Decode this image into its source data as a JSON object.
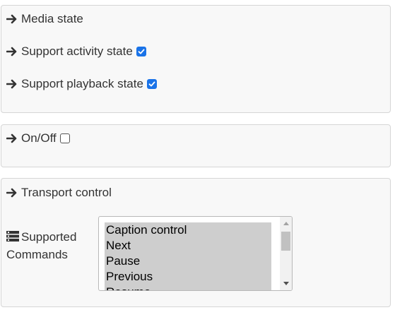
{
  "media_state": {
    "title": "Media state",
    "support_activity_label": "Support activity state",
    "support_activity_checked": true,
    "support_playback_label": "Support playback state",
    "support_playback_checked": true
  },
  "on_off": {
    "label": "On/Off",
    "checked": false
  },
  "transport": {
    "title": "Transport control",
    "commands_label_line1": "Supported",
    "commands_label_line2": "Commands",
    "options": [
      "Caption control",
      "Next",
      "Pause",
      "Previous",
      "Resume"
    ]
  },
  "icons": {
    "arrow": "arrow-right-icon",
    "list": "list-icon",
    "checkbox": "checkbox-icon"
  },
  "colors": {
    "accent": "#1a73e8",
    "panel_bg": "#f8f8f8",
    "panel_border": "#d6d6d6",
    "selected_bg": "#cecece"
  }
}
